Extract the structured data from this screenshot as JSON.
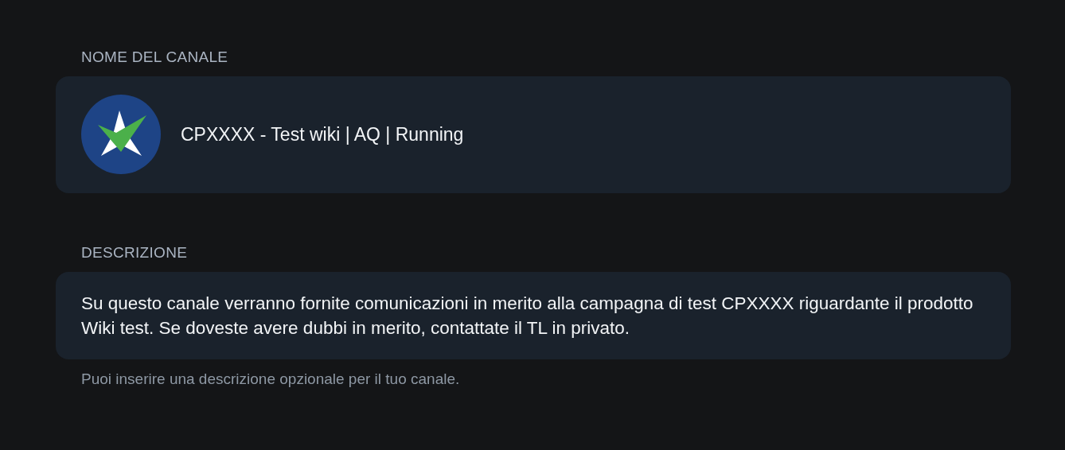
{
  "channel_name": {
    "label": "NOME DEL CANALE",
    "value": "CPXXXX - Test wiki | AQ | Running"
  },
  "description": {
    "label": "DESCRIZIONE",
    "value": "Su questo canale verranno fornite comunicazioni in merito alla campagna di test CPXXXX riguardante il prodotto Wiki test. Se doveste avere dubbi in merito, contattate il TL in privato.",
    "hint": "Puoi inserire una descrizione opzionale per il tuo canale."
  }
}
